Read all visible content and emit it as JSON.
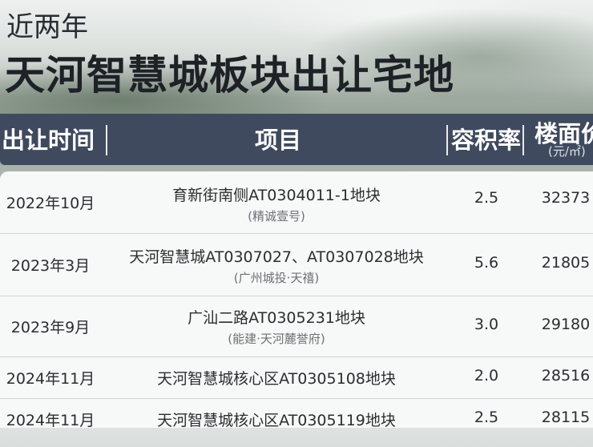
{
  "title": {
    "line1": "近两年",
    "line2": "天河智慧城板块出让宅地"
  },
  "header": {
    "date": "出让时间",
    "project": "项目",
    "ratio": "容积率",
    "price": "楼面价",
    "price_unit": "(元/㎡)"
  },
  "rows": [
    {
      "date": "2022年10月",
      "project": "育新街南侧AT0304011-1地块",
      "sub": "(精诚壹号)",
      "ratio": "2.5",
      "price": "32373"
    },
    {
      "date": "2023年3月",
      "project": "天河智慧城AT0307027、AT0307028地块",
      "sub": "(广州城投·天禧)",
      "ratio": "5.6",
      "price": "21805"
    },
    {
      "date": "2023年9月",
      "project": "广汕二路AT0305231地块",
      "sub": "(能建·天河麓誉府)",
      "ratio": "3.0",
      "price": "29180"
    },
    {
      "date": "2024年11月",
      "project": "天河智慧城核心区AT0305108地块",
      "sub": null,
      "ratio": "2.0",
      "price": "28516"
    },
    {
      "date": "2024年11月",
      "project": "天河智慧城核心区AT0305119地块",
      "sub": null,
      "ratio": "2.5",
      "price": "28115"
    }
  ],
  "colors": {
    "header_bg": "#3f4a5e",
    "table_bg": "#f7f8f8"
  }
}
